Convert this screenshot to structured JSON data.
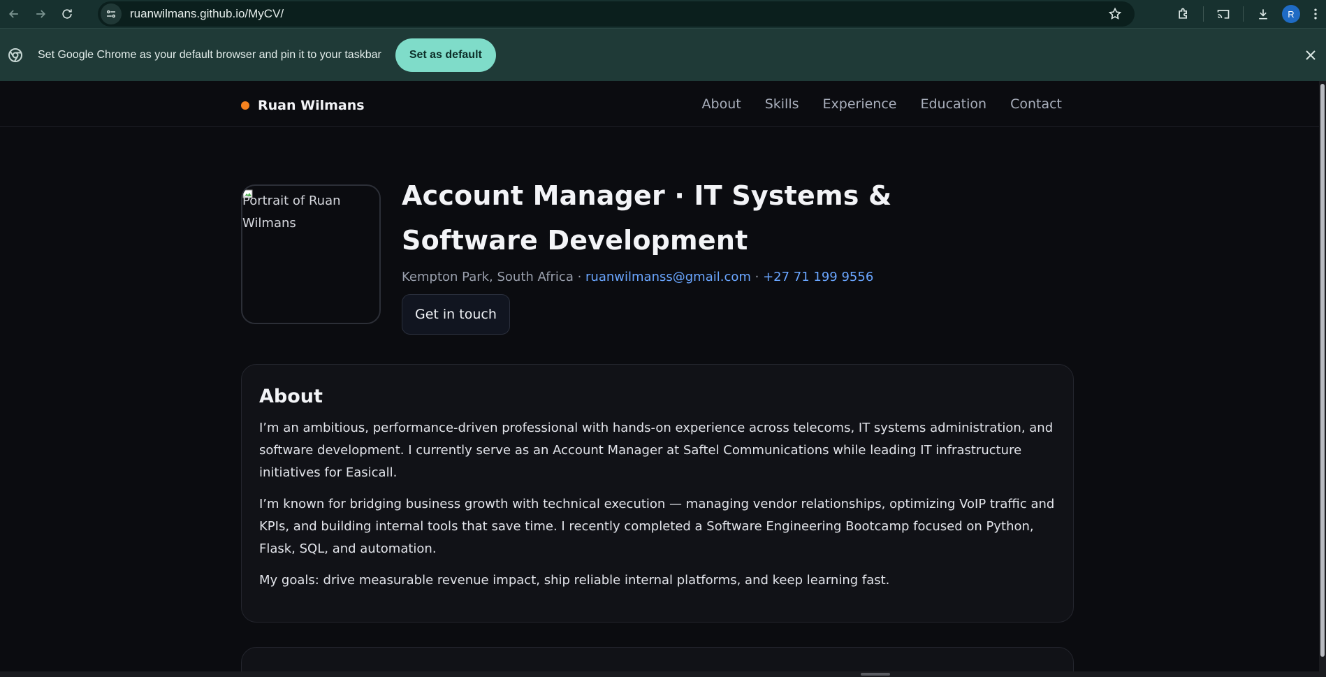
{
  "browser": {
    "url": "ruanwilmans.github.io/MyCV/",
    "profile_initial": "R",
    "infobar_message": "Set Google Chrome as your default browser and pin it to your taskbar",
    "infobar_button": "Set as default"
  },
  "site": {
    "brand_name": "Ruan Wilmans",
    "nav": [
      "About",
      "Skills",
      "Experience",
      "Education",
      "Contact"
    ]
  },
  "hero": {
    "portrait_alt": "Portrait of Ruan Wilmans",
    "title": "Account Manager · IT Systems & Software Development",
    "location": "Kempton Park, South Africa",
    "separator": " · ",
    "email": "ruanwilmanss@gmail.com",
    "phone": "+27 71 199 9556",
    "cta": "Get in touch"
  },
  "about": {
    "heading": "About",
    "paragraphs": [
      "I’m an ambitious, performance-driven professional with hands-on experience across telecoms, IT systems administration, and software development. I currently serve as an Account Manager at Saftel Communications while leading IT infrastructure initiatives for Easicall.",
      "I’m known for bridging business growth with technical execution — managing vendor relationships, optimizing VoIP traffic and KPIs, and building internal tools that save time. I recently completed a Software Engineering Bootcamp focused on Python, Flask, SQL, and automation.",
      "My goals: drive measurable revenue impact, ship reliable internal platforms, and keep learning fast."
    ]
  },
  "colors": {
    "page_bg": "#0b0c10",
    "brand_dot": "#f5821f",
    "link": "#6aa6ff",
    "infobar_button": "#7fdcc9"
  },
  "icons": [
    "back-icon",
    "forward-icon",
    "reload-icon",
    "site-info-icon",
    "bookmark-star-icon",
    "extensions-icon",
    "cast-icon",
    "download-icon",
    "menu-icon",
    "chrome-logo-icon",
    "close-icon"
  ]
}
